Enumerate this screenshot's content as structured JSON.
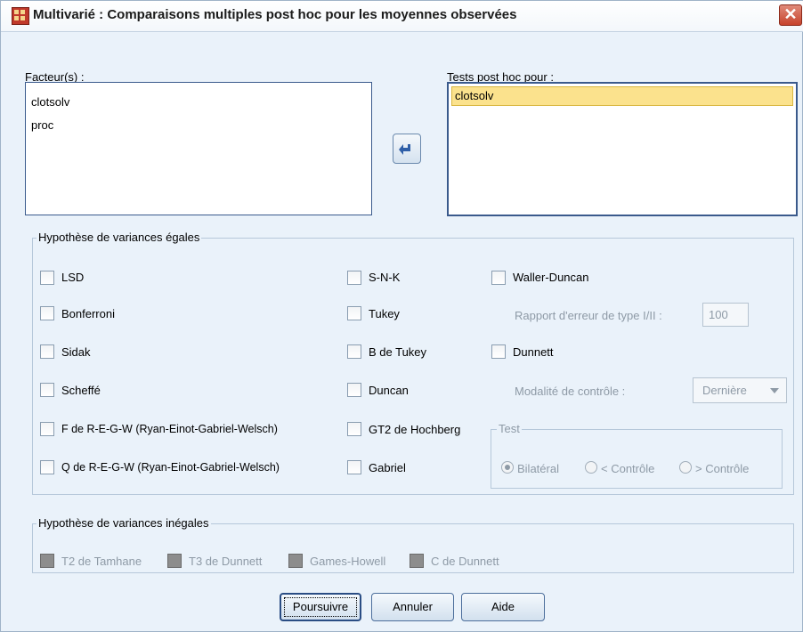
{
  "window": {
    "title": "Multivarié : Comparaisons multiples post hoc pour les moyennes observées",
    "close_glyph": "✕"
  },
  "factors": {
    "label": "Facteur(s) :",
    "items": [
      "clotsolv",
      "proc"
    ]
  },
  "move_button": {
    "icon": "arrow-left-icon"
  },
  "posthoc": {
    "label": "Tests post hoc pour :",
    "items": [
      "clotsolv"
    ]
  },
  "equal_variances": {
    "legend": "Hypothèse de variances égales",
    "col1": [
      "LSD",
      "Bonferroni",
      "Sidak",
      "Scheffé",
      "F de R-E-G-W (Ryan-Einot-Gabriel-Welsch)",
      "Q de R-E-G-W (Ryan-Einot-Gabriel-Welsch)"
    ],
    "col2": [
      "S-N-K",
      "Tukey",
      "B de Tukey",
      "Duncan",
      "GT2 de Hochberg",
      "Gabriel"
    ],
    "waller_duncan": "Waller-Duncan",
    "error_ratio_label": "Rapport d'erreur de type I/II :",
    "error_ratio_value": "100",
    "dunnett": "Dunnett",
    "control_category_label": "Modalité de contrôle :",
    "control_category_value": "Dernière",
    "test_group": {
      "legend": "Test",
      "options": [
        "Bilatéral",
        "< Contrôle",
        "> Contrôle"
      ],
      "selected": "Bilatéral"
    }
  },
  "unequal_variances": {
    "legend": "Hypothèse de variances inégales",
    "items": [
      "T2 de Tamhane",
      "T3 de Dunnett",
      "Games-Howell",
      "C de Dunnett"
    ]
  },
  "buttons": {
    "continue": "Poursuivre",
    "cancel": "Annuler",
    "help": "Aide"
  },
  "colors": {
    "dialog_bg": "#eaf2fa",
    "selection_highlight": "#fbe28d",
    "listbox_border": "#3a5a8c",
    "disabled_text": "#8e9aa6",
    "close_button": "#c7432c"
  }
}
